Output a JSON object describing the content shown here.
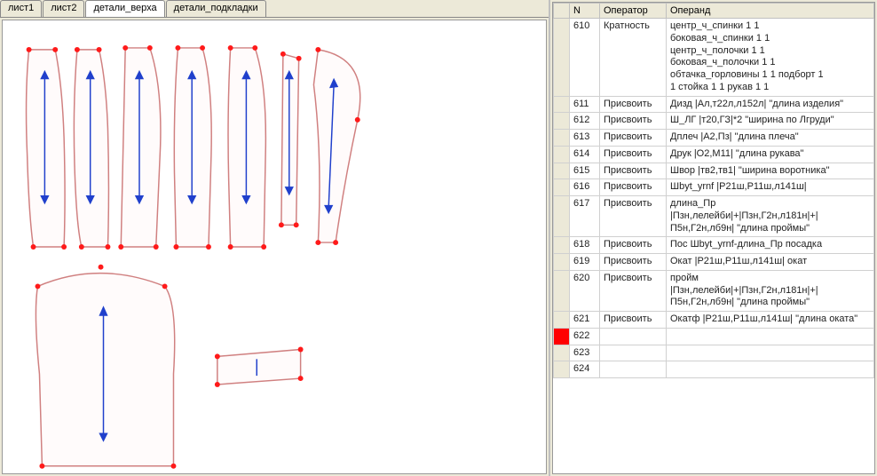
{
  "tabs": [
    {
      "label": "лист1",
      "active": false
    },
    {
      "label": "лист2",
      "active": false
    },
    {
      "label": "детали_верха",
      "active": true
    },
    {
      "label": "детали_подкладки",
      "active": false
    }
  ],
  "grid": {
    "headers": {
      "n": "N",
      "operator": "Оператор",
      "operand": "Операнд"
    },
    "rows": [
      {
        "n": "610",
        "operator": "Кратность",
        "operand": "центр_ч_спинки 1 1\nбоковая_ч_спинки 1 1\nцентр_ч_полочки 1 1\nбоковая_ч_полочки 1 1\nобтачка_горловины 1 1 подборт 1\n1 стойка 1 1 рукав 1 1"
      },
      {
        "n": "611",
        "operator": "Присвоить",
        "operand": "Дизд |Ал,т22л,л152л| \"длина изделия\""
      },
      {
        "n": "612",
        "operator": "Присвоить",
        "operand": "Ш_ЛГ |т20,ГЗ|*2 \"ширина по Лгруди\""
      },
      {
        "n": "613",
        "operator": "Присвоить",
        "operand": "Дплеч |А2,Пз| \"длина плеча\""
      },
      {
        "n": "614",
        "operator": "Присвоить",
        "operand": "Друк |О2,М11| \"длина рукава\""
      },
      {
        "n": "615",
        "operator": "Присвоить",
        "operand": "Швор |тв2,тв1| \"ширина воротника\""
      },
      {
        "n": "616",
        "operator": "Присвоить",
        "operand": "Шbyt_yrnf |Р21ш,Р11ш,л141ш|"
      },
      {
        "n": "617",
        "operator": "Присвоить",
        "operand": "длина_Пр\n|Пзн,лелейби|+|Пзн,Г2н,л181н|+|\nП5н,Г2н,лб9н| \"длина проймы\""
      },
      {
        "n": "618",
        "operator": "Присвоить",
        "operand": "Пос Шbyt_yrnf-длина_Пр посадка"
      },
      {
        "n": "619",
        "operator": "Присвоить",
        "operand": "Окат |Р21ш,Р11ш,л141ш| окат"
      },
      {
        "n": "620",
        "operator": "Присвоить",
        "operand": "пройм\n|Пзн,лелейби|+|Пзн,Г2н,л181н|+|\nП5н,Г2н,лб9н| \"длина проймы\""
      },
      {
        "n": "621",
        "operator": "Присвоить",
        "operand": "Окатф |Р21ш,Р11ш,л141ш| \"длина оката\""
      },
      {
        "n": "622",
        "operator": "",
        "operand": "",
        "current": true
      },
      {
        "n": "623",
        "operator": "",
        "operand": ""
      },
      {
        "n": "624",
        "operator": "",
        "operand": ""
      }
    ]
  }
}
